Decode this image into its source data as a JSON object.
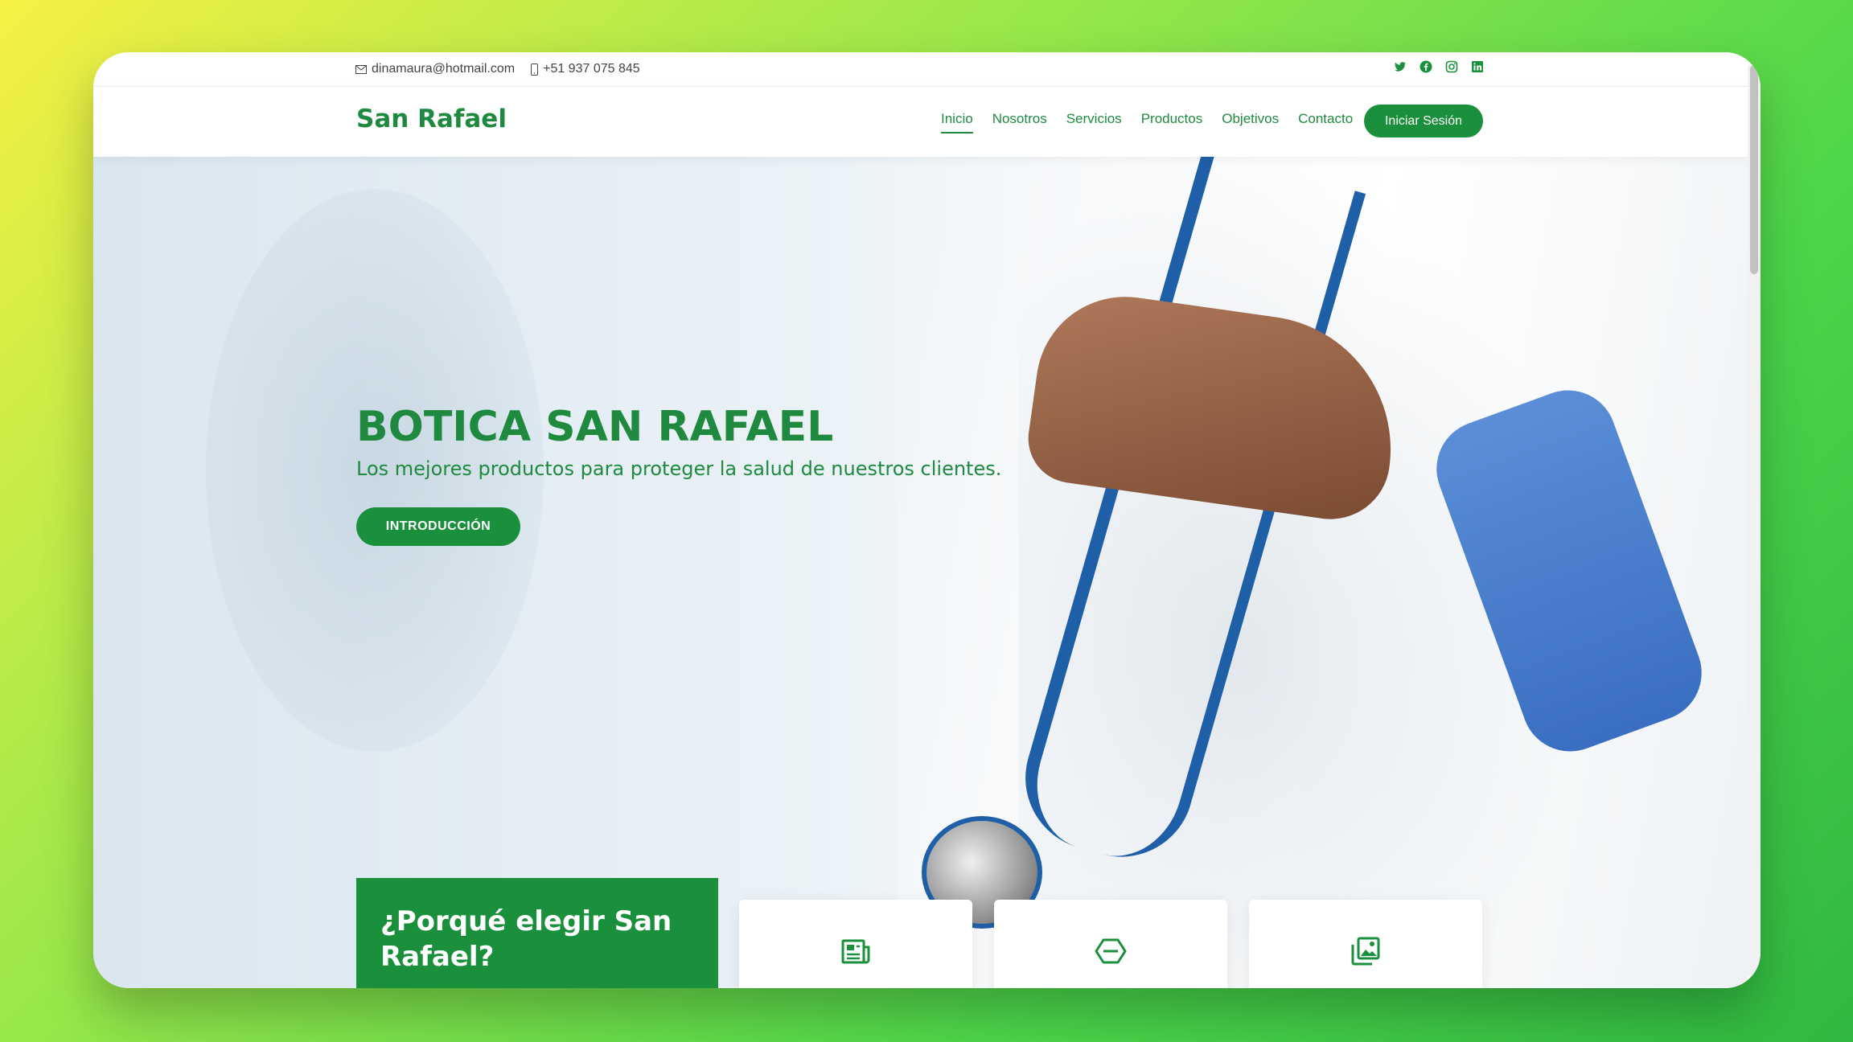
{
  "topbar": {
    "email": "dinamaura@hotmail.com",
    "phone": "+51 937 075 845",
    "social": [
      "twitter-icon",
      "facebook-icon",
      "instagram-icon",
      "linkedin-icon"
    ]
  },
  "navbar": {
    "logo": "San Rafael",
    "links": [
      "Inicio",
      "Nosotros",
      "Servicios",
      "Productos",
      "Objetivos",
      "Contacto"
    ],
    "active": "Inicio",
    "login_label": "Iniciar Sesión"
  },
  "hero": {
    "title": "BOTICA SAN RAFAEL",
    "subtitle": "Los mejores productos para proteger la salud de nuestros clientes.",
    "button_label": "INTRODUCCIÓN"
  },
  "features": {
    "heading": "¿Porqué elegir San Rafael?",
    "cards": [
      "document-icon",
      "hexagon-icon",
      "images-icon"
    ]
  },
  "colors": {
    "brand_green": "#1a8f3c",
    "text_green": "#1f8a3f"
  }
}
